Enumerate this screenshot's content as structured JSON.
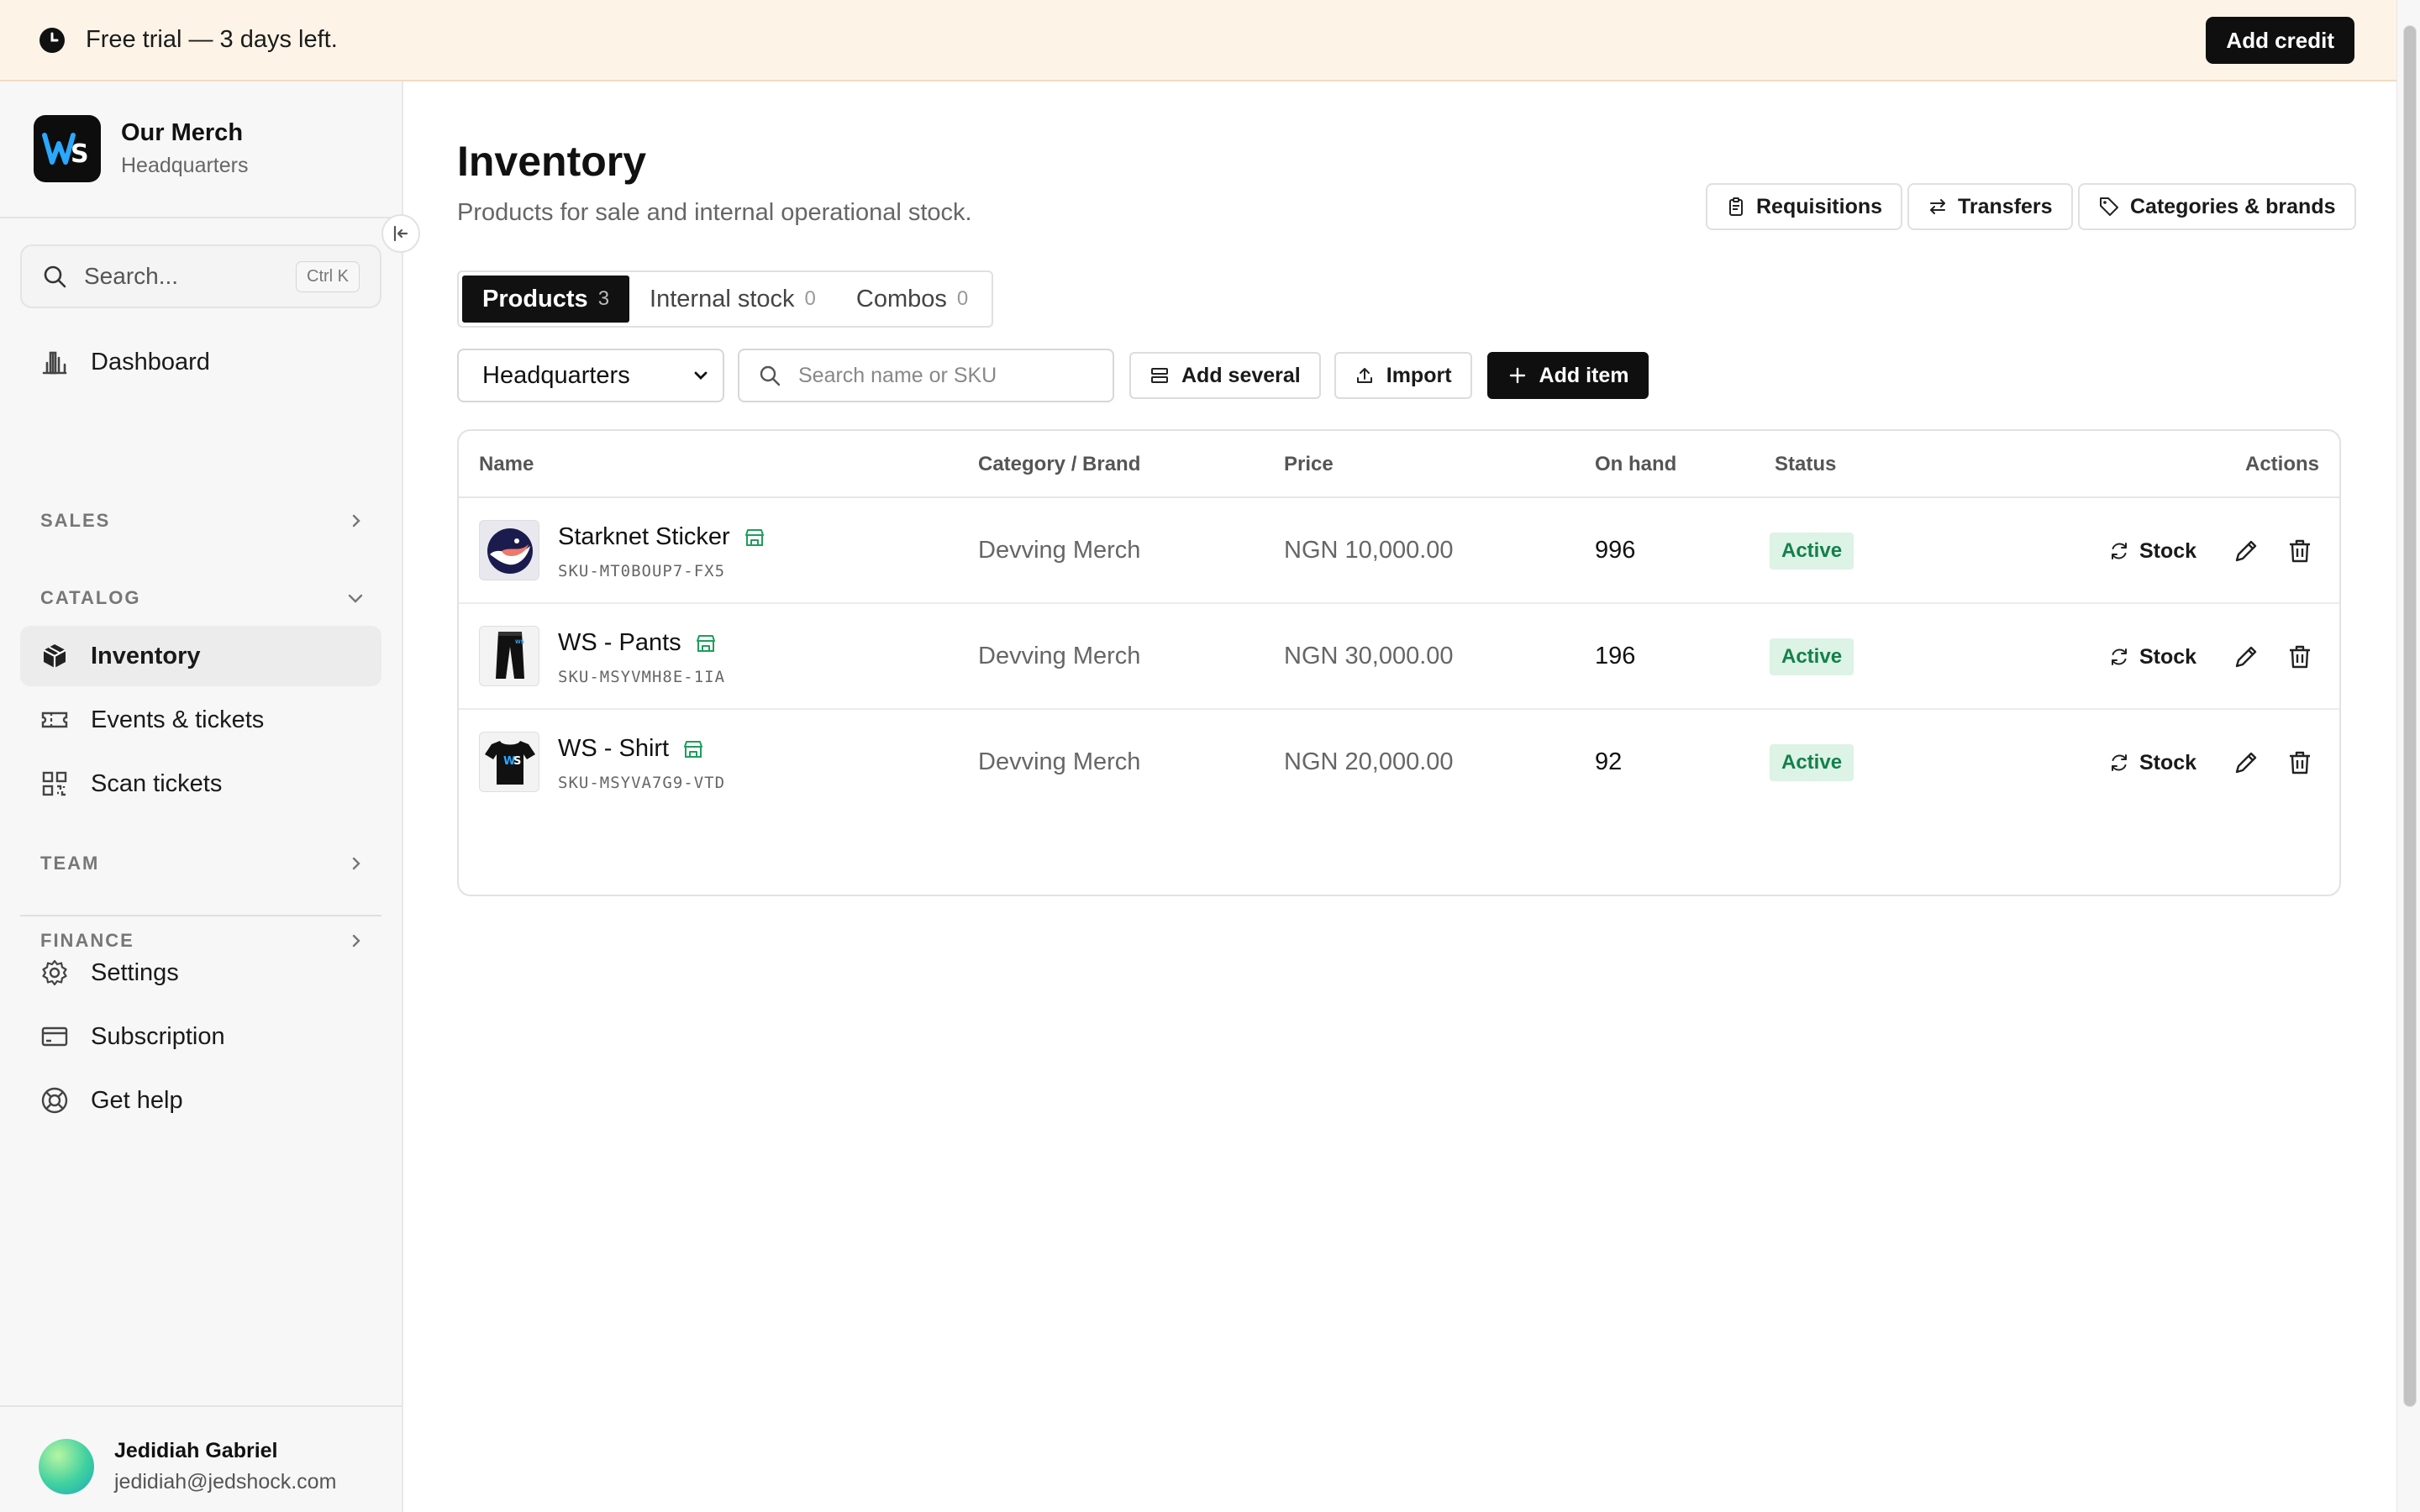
{
  "banner": {
    "text": "Free trial — 3 days left.",
    "credit_button": "Add credit"
  },
  "org": {
    "name": "Our Merch",
    "location": "Headquarters",
    "logo_text": "WS"
  },
  "sidebar": {
    "search_placeholder": "Search...",
    "search_shortcut": "Ctrl K",
    "dashboard": "Dashboard",
    "sections": {
      "sales": "SALES",
      "catalog": "CATALOG",
      "team": "TEAM",
      "finance": "FINANCE"
    },
    "catalog_items": [
      "Inventory",
      "Events & tickets",
      "Scan tickets"
    ],
    "footer_items": [
      "Settings",
      "Subscription",
      "Get help"
    ]
  },
  "user": {
    "name": "Jedidiah Gabriel",
    "email": "jedidiah@jedshock.com"
  },
  "page": {
    "title": "Inventory",
    "subtitle": "Products for sale and internal operational stock."
  },
  "header_buttons": {
    "requisitions": "Requisitions",
    "transfers": "Transfers",
    "categories": "Categories & brands"
  },
  "tabs": [
    {
      "label": "Products",
      "count": "3",
      "active": true
    },
    {
      "label": "Internal stock",
      "count": "0",
      "active": false
    },
    {
      "label": "Combos",
      "count": "0",
      "active": false
    }
  ],
  "toolbar": {
    "location_select": "Headquarters",
    "search_placeholder": "Search name or SKU",
    "add_several": "Add several",
    "import": "Import",
    "add_item": "Add item"
  },
  "table": {
    "columns": [
      "Name",
      "Category / Brand",
      "Price",
      "On hand",
      "Status",
      "Actions"
    ],
    "rows": [
      {
        "name": "Starknet Sticker",
        "sku": "SKU-MT0BOUP7-FX5",
        "category": "Devving Merch",
        "price": "NGN 10,000.00",
        "on_hand": "996",
        "status": "Active",
        "stock_label": "Stock",
        "thumb": "starknet-logo"
      },
      {
        "name": "WS - Pants",
        "sku": "SKU-MSYVMH8E-1IA",
        "category": "Devving Merch",
        "price": "NGN 30,000.00",
        "on_hand": "196",
        "status": "Active",
        "stock_label": "Stock",
        "thumb": "pants"
      },
      {
        "name": "WS - Shirt",
        "sku": "SKU-MSYVA7G9-VTD",
        "category": "Devving Merch",
        "price": "NGN 20,000.00",
        "on_hand": "92",
        "status": "Active",
        "stock_label": "Stock",
        "thumb": "shirt"
      }
    ]
  },
  "colors": {
    "banner_bg": "#fdf4e7",
    "primary": "#0f0f0f",
    "active_badge_bg": "#dcf3e6",
    "active_badge_text": "#14804a",
    "store_icon": "#1f9d5c"
  }
}
